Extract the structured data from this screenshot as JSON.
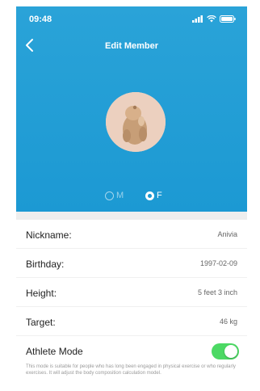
{
  "status_bar": {
    "time": "09:48"
  },
  "nav": {
    "title": "Edit Member"
  },
  "gender": {
    "male_label": "M",
    "female_label": "F",
    "selected": "F"
  },
  "fields": [
    {
      "label": "Nickname:",
      "value": "Anivia"
    },
    {
      "label": "Birthday:",
      "value": "1997-02-09"
    },
    {
      "label": "Height:",
      "value": "5 feet 3 inch"
    },
    {
      "label": "Target:",
      "value": "46 kg"
    }
  ],
  "athlete_mode": {
    "label": "Athlete Mode",
    "enabled": true,
    "note": "This mode is suitable for people who has long been engaged in physical exercise or who regularly exercises. It will adjust the body composition calculation model."
  },
  "colors": {
    "header": "#1c99d3",
    "toggle_on": "#4cd964"
  }
}
